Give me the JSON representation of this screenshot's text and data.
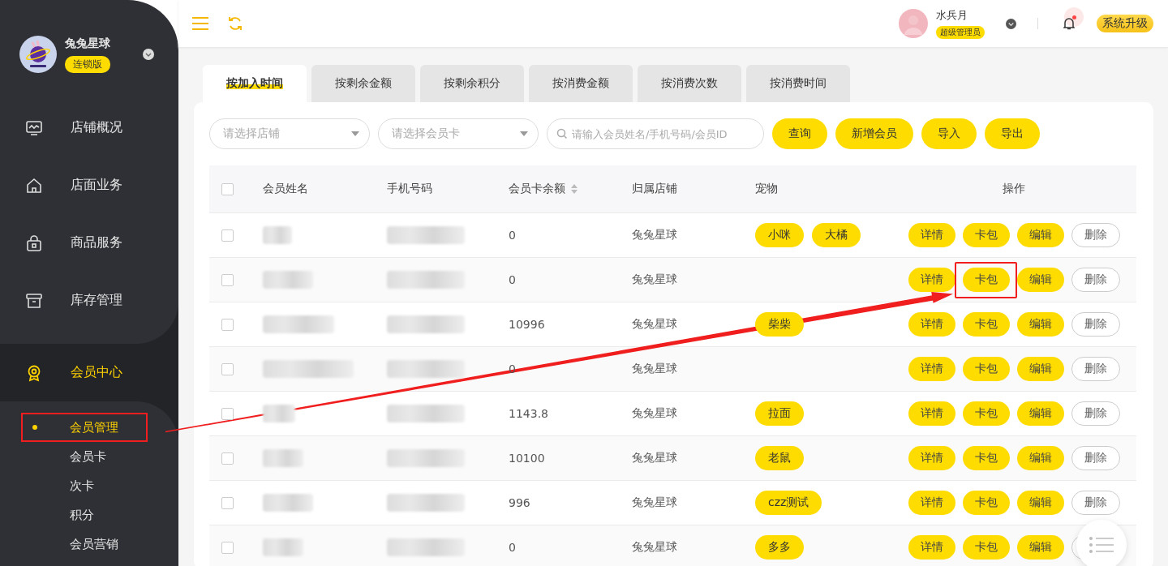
{
  "sidebar": {
    "brand": {
      "name": "兔兔星球",
      "edition": "连锁版"
    },
    "menu": [
      {
        "label": "店铺概况",
        "selected": false
      },
      {
        "label": "店面业务",
        "selected": false
      },
      {
        "label": "商品服务",
        "selected": false
      },
      {
        "label": "库存管理",
        "selected": false
      },
      {
        "label": "会员中心",
        "selected": true,
        "children": [
          {
            "label": "会员管理",
            "selected": true,
            "highlighted": true
          },
          {
            "label": "会员卡",
            "selected": false,
            "highlighted": false
          },
          {
            "label": "次卡",
            "selected": false,
            "highlighted": false
          },
          {
            "label": "积分",
            "selected": false,
            "highlighted": false
          },
          {
            "label": "会员营销",
            "selected": false,
            "highlighted": false
          }
        ]
      }
    ]
  },
  "topbar": {
    "user": {
      "name": "水兵月",
      "role": "超级管理员"
    },
    "has_unread": true,
    "upgrade": "系统升级"
  },
  "tabs": [
    {
      "label": "按加入时间",
      "selected": true
    },
    {
      "label": "按剩余金额",
      "selected": false
    },
    {
      "label": "按剩余积分",
      "selected": false
    },
    {
      "label": "按消费金额",
      "selected": false
    },
    {
      "label": "按消费次数",
      "selected": false
    },
    {
      "label": "按消费时间",
      "selected": false
    }
  ],
  "filters": {
    "store": {
      "placeholder": "请选择店铺"
    },
    "card": {
      "placeholder": "请选择会员卡"
    },
    "search": {
      "placeholder": "请输入会员姓名/手机号码/会员ID"
    },
    "buttons": [
      "查询",
      "新增会员",
      "导入",
      "导出"
    ]
  },
  "table": {
    "header_checked": false,
    "columns": [
      {
        "label": "会员姓名",
        "sortable": false
      },
      {
        "label": "手机号码",
        "sortable": false
      },
      {
        "label": "会员卡余额",
        "sortable": true
      },
      {
        "label": "归属店铺",
        "sortable": false
      },
      {
        "label": "宠物",
        "sortable": false
      },
      {
        "label": "操作",
        "sortable": false
      }
    ],
    "rows": [
      {
        "checked": false,
        "balance": "0",
        "store": "兔兔星球",
        "pets": [
          "小咪",
          "大橘"
        ],
        "actions": [
          {
            "label": "详情",
            "kind": "filled",
            "highlighted": false
          },
          {
            "label": "卡包",
            "kind": "filled",
            "highlighted": false
          },
          {
            "label": "编辑",
            "kind": "filled",
            "highlighted": false
          },
          {
            "label": "删除",
            "kind": "outline",
            "highlighted": false
          }
        ]
      },
      {
        "checked": false,
        "balance": "0",
        "store": "兔兔星球",
        "pets": [],
        "actions": [
          {
            "label": "详情",
            "kind": "filled",
            "highlighted": false
          },
          {
            "label": "卡包",
            "kind": "filled",
            "highlighted": true
          },
          {
            "label": "编辑",
            "kind": "filled",
            "highlighted": false
          },
          {
            "label": "删除",
            "kind": "outline",
            "highlighted": false
          }
        ]
      },
      {
        "checked": false,
        "balance": "10996",
        "store": "兔兔星球",
        "pets": [
          "柴柴"
        ],
        "actions": [
          {
            "label": "详情",
            "kind": "filled",
            "highlighted": false
          },
          {
            "label": "卡包",
            "kind": "filled",
            "highlighted": false
          },
          {
            "label": "编辑",
            "kind": "filled",
            "highlighted": false
          },
          {
            "label": "删除",
            "kind": "outline",
            "highlighted": false
          }
        ]
      },
      {
        "checked": false,
        "balance": "0",
        "store": "兔兔星球",
        "pets": [],
        "actions": [
          {
            "label": "详情",
            "kind": "filled",
            "highlighted": false
          },
          {
            "label": "卡包",
            "kind": "filled",
            "highlighted": false
          },
          {
            "label": "编辑",
            "kind": "filled",
            "highlighted": false
          },
          {
            "label": "删除",
            "kind": "outline",
            "highlighted": false
          }
        ]
      },
      {
        "checked": false,
        "balance": "1143.8",
        "store": "兔兔星球",
        "pets": [
          "拉面"
        ],
        "actions": [
          {
            "label": "详情",
            "kind": "filled",
            "highlighted": false
          },
          {
            "label": "卡包",
            "kind": "filled",
            "highlighted": false
          },
          {
            "label": "编辑",
            "kind": "filled",
            "highlighted": false
          },
          {
            "label": "删除",
            "kind": "outline",
            "highlighted": false
          }
        ]
      },
      {
        "checked": false,
        "balance": "10100",
        "store": "兔兔星球",
        "pets": [
          "老鼠"
        ],
        "actions": [
          {
            "label": "详情",
            "kind": "filled",
            "highlighted": false
          },
          {
            "label": "卡包",
            "kind": "filled",
            "highlighted": false
          },
          {
            "label": "编辑",
            "kind": "filled",
            "highlighted": false
          },
          {
            "label": "删除",
            "kind": "outline",
            "highlighted": false
          }
        ]
      },
      {
        "checked": false,
        "balance": "996",
        "store": "兔兔星球",
        "pets": [
          "czz测试"
        ],
        "actions": [
          {
            "label": "详情",
            "kind": "filled",
            "highlighted": false
          },
          {
            "label": "卡包",
            "kind": "filled",
            "highlighted": false
          },
          {
            "label": "编辑",
            "kind": "filled",
            "highlighted": false
          },
          {
            "label": "删除",
            "kind": "outline",
            "highlighted": false
          }
        ]
      },
      {
        "checked": false,
        "balance": "0",
        "store": "兔兔星球",
        "pets": [
          "多多"
        ],
        "actions": [
          {
            "label": "详情",
            "kind": "filled",
            "highlighted": false
          },
          {
            "label": "卡包",
            "kind": "filled",
            "highlighted": false
          },
          {
            "label": "编辑",
            "kind": "filled",
            "highlighted": false
          },
          {
            "kind": "outline",
            "highlighted": false
          }
        ]
      }
    ]
  }
}
